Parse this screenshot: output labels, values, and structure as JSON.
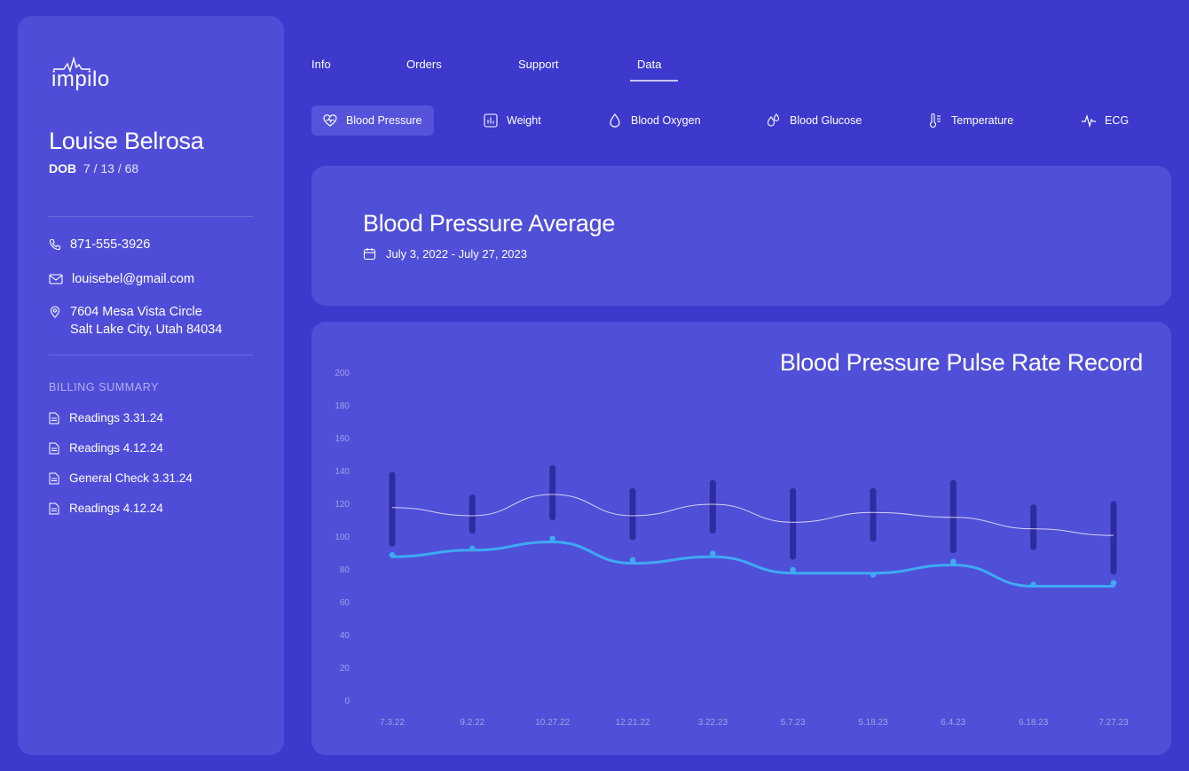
{
  "brand": {
    "logo_text": "impilo"
  },
  "patient": {
    "name": "Louise Belrosa",
    "dob_label": "DOB",
    "dob_value": "7 / 13 / 68",
    "phone": "871-555-3926",
    "email": "louisebel@gmail.com",
    "address_line1": "7604 Mesa Vista Circle",
    "address_line2": "Salt Lake City, Utah 84034"
  },
  "billing": {
    "title": "BILLING SUMMARY",
    "items": [
      {
        "label": "Readings 3.31.24",
        "icon": "document-icon"
      },
      {
        "label": "Readings 4.12.24",
        "icon": "document-icon"
      },
      {
        "label": "General Check 3.31.24",
        "icon": "document-icon"
      },
      {
        "label": "Readings 4.12.24",
        "icon": "document-icon"
      }
    ]
  },
  "tabs": [
    {
      "label": "Info",
      "active": false
    },
    {
      "label": "Orders",
      "active": false
    },
    {
      "label": "Support",
      "active": false
    },
    {
      "label": "Data",
      "active": true
    }
  ],
  "metrics": [
    {
      "label": "Blood Pressure",
      "icon": "heart-pulse-icon",
      "active": true
    },
    {
      "label": "Weight",
      "icon": "bar-chart-icon",
      "active": false
    },
    {
      "label": "Blood Oxygen",
      "icon": "droplet-icon",
      "active": false
    },
    {
      "label": "Blood Glucose",
      "icon": "droplets-icon",
      "active": false
    },
    {
      "label": "Temperature",
      "icon": "thermometer-icon",
      "active": false
    },
    {
      "label": "ECG",
      "icon": "ecg-icon",
      "active": false
    }
  ],
  "average": {
    "title": "Blood Pressure Average",
    "date_range": "July 3, 2022 - July 27, 2023",
    "icon": "calendar-icon"
  },
  "colors": {
    "background": "#3c39cc",
    "panel": "#4f4dd8",
    "range_bar": "#2e2c9e",
    "pulse_line": "#3fa9f5",
    "avg_line": "#ffffff"
  },
  "chart_data": {
    "type": "line",
    "title": "Blood Pressure Pulse Rate Record",
    "x": [
      "7.3.22",
      "9.2.22",
      "10.27.22",
      "12.21.22",
      "3.22.23",
      "5.7.23",
      "5.18.23",
      "6.4.23",
      "6.18.23",
      "7.27.23"
    ],
    "ylim": [
      0,
      200
    ],
    "yticks": [
      0,
      20,
      40,
      60,
      80,
      100,
      120,
      140,
      160,
      180,
      200
    ],
    "grid": false,
    "ranges": [
      {
        "low": 96,
        "high": 138
      },
      {
        "low": 104,
        "high": 124
      },
      {
        "low": 112,
        "high": 142
      },
      {
        "low": 100,
        "high": 128
      },
      {
        "low": 104,
        "high": 133
      },
      {
        "low": 88,
        "high": 128
      },
      {
        "low": 99,
        "high": 128
      },
      {
        "low": 92,
        "high": 133
      },
      {
        "low": 94,
        "high": 118
      },
      {
        "low": 79,
        "high": 120
      }
    ],
    "series": [
      {
        "values": [
          118,
          113,
          126,
          113,
          120,
          109,
          115,
          112,
          105,
          101
        ]
      },
      {
        "values": [
          88,
          92,
          97,
          84,
          88,
          78,
          78,
          83,
          70,
          70
        ]
      }
    ],
    "pulse_points": [
      89,
      93,
      99,
      86,
      90,
      80,
      77,
      85,
      71,
      72
    ]
  }
}
